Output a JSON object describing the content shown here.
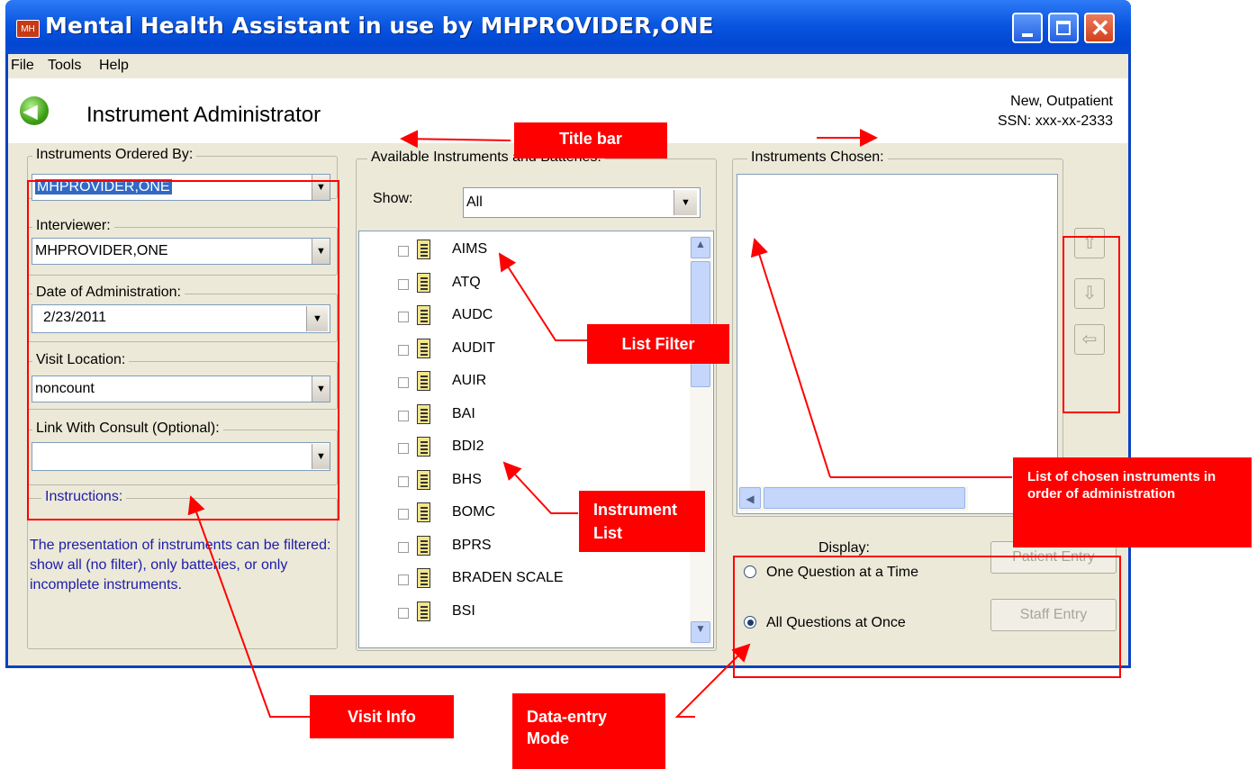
{
  "window": {
    "title": "Mental Health Assistant in use by MHPROVIDER,ONE"
  },
  "menu": {
    "file": "File",
    "tools": "Tools",
    "help": "Help"
  },
  "header": {
    "title": "Instrument Administrator",
    "patient_type": "New, Outpatient",
    "ssn": "SSN: xxx-xx-2333"
  },
  "left": {
    "ordered_by": {
      "label": "Instruments Ordered By:",
      "value": "MHPROVIDER,ONE"
    },
    "interviewer": {
      "label": "Interviewer:",
      "value": "MHPROVIDER,ONE"
    },
    "date": {
      "label": "Date of Administration:",
      "value": "2/23/2011"
    },
    "location": {
      "label": "Visit Location:",
      "value": "noncount"
    },
    "consult": {
      "label": "Link With Consult (Optional):",
      "value": ""
    },
    "instructions": {
      "label": "Instructions:",
      "text": "The presentation of instruments can be filtered: show all (no filter), only batteries, or only incomplete instruments."
    }
  },
  "middle": {
    "label": "Available Instruments and Batteries:",
    "show_label": "Show:",
    "show_value": "All",
    "items": [
      "AIMS",
      "ATQ",
      "AUDC",
      "AUDIT",
      "AUIR",
      "BAI",
      "BDI2",
      "BHS",
      "BOMC",
      "BPRS",
      "BRADEN SCALE",
      "BSI"
    ]
  },
  "right": {
    "label": "Instruments Chosen:",
    "display_label": "Display:",
    "one_question": "One Question at a Time",
    "all_questions": "All Questions at Once",
    "patient_entry": "Patient Entry",
    "staff_entry": "Staff Entry"
  },
  "callouts": {
    "title_bar": "Title bar",
    "list_filter": "List Filter",
    "instrument_list": "Instrument List",
    "chosen": "List of chosen instruments in order of administration",
    "visit_info": "Visit Info",
    "data_entry": "Data-entry Mode"
  },
  "colors": {
    "title_bar": "#0a56e0",
    "callout": "#ff0000",
    "window_bg": "#ece9d8"
  }
}
